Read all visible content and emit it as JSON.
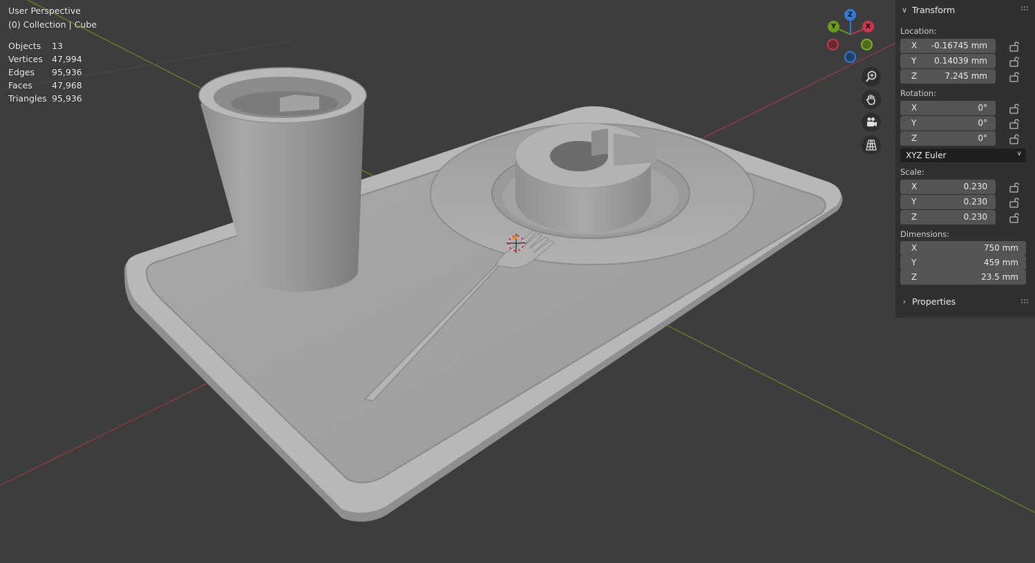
{
  "overlay": {
    "perspective": "User Perspective",
    "context": "(0) Collection | Cube",
    "stats": [
      {
        "label": "Objects",
        "value": "13"
      },
      {
        "label": "Vertices",
        "value": "47,994"
      },
      {
        "label": "Edges",
        "value": "95,936"
      },
      {
        "label": "Faces",
        "value": "47,968"
      },
      {
        "label": "Triangles",
        "value": "95,936"
      }
    ]
  },
  "gizmo": {
    "z": "Z",
    "y": "Y",
    "x": "X",
    "colors": {
      "x": "#c9364c",
      "y": "#6a9a1f",
      "z": "#2f7bd6"
    }
  },
  "nav_buttons": [
    "zoom-icon",
    "hand-pan-icon",
    "camera-icon",
    "grid-perspective-icon"
  ],
  "panel": {
    "transform_title": "Transform",
    "location_label": "Location:",
    "location": [
      {
        "axis": "X",
        "value": "-0.16745 mm"
      },
      {
        "axis": "Y",
        "value": "0.14039 mm"
      },
      {
        "axis": "Z",
        "value": "7.245 mm"
      }
    ],
    "rotation_label": "Rotation:",
    "rotation": [
      {
        "axis": "X",
        "value": "0°"
      },
      {
        "axis": "Y",
        "value": "0°"
      },
      {
        "axis": "Z",
        "value": "0°"
      }
    ],
    "rotation_mode": "XYZ Euler",
    "scale_label": "Scale:",
    "scale": [
      {
        "axis": "X",
        "value": "0.230"
      },
      {
        "axis": "Y",
        "value": "0.230"
      },
      {
        "axis": "Z",
        "value": "0.230"
      }
    ],
    "dimensions_label": "Dimensions:",
    "dimensions": [
      {
        "axis": "X",
        "value": "750 mm"
      },
      {
        "axis": "Y",
        "value": "459 mm"
      },
      {
        "axis": "Z",
        "value": "23.5 mm"
      }
    ],
    "properties_title": "Properties"
  },
  "colors": {
    "viewport_bg": "#3d3d3d",
    "x_axis_line": "#9b3a46",
    "y_axis_line": "#6b8a23",
    "panel_bg": "#303030",
    "field_bg": "#545454"
  }
}
